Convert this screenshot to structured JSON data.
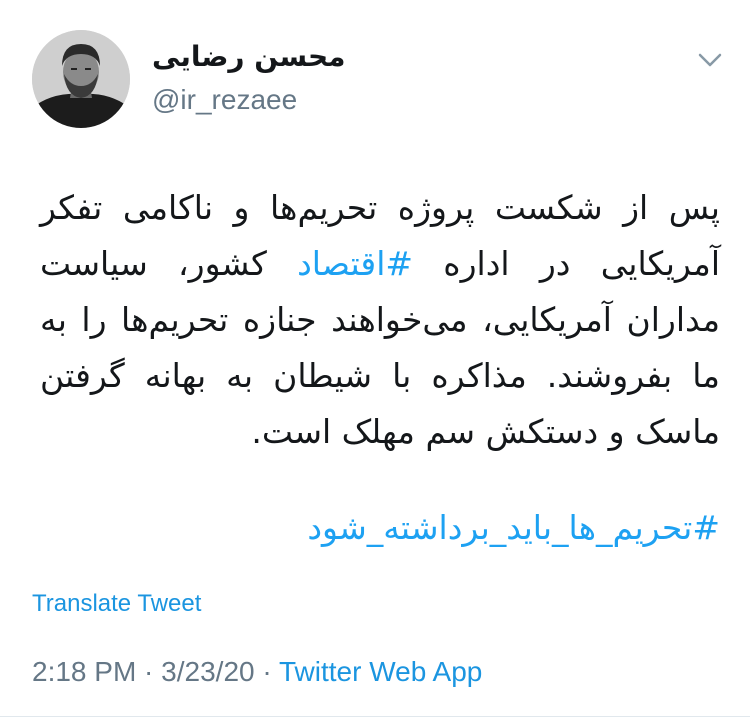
{
  "author": {
    "display_name": "محسن رضایی",
    "handle": "@ir_rezaee"
  },
  "tweet": {
    "text_before_hashtag": "پس از شکست پروژه تحریم‌ها و ناکامی تفکر آمریکایی در اداره ",
    "inline_hashtag": "#اقتصاد",
    "text_after_hashtag": " کشور، سیاست مداران آمریکایی، می‌خواهند جنازه تحریم‌ها را به ما بفروشند. مذاکره با شیطان به بهانه گرفتن ماسک و دستکش سم مهلک است.",
    "closing_hashtag": "#تحریم_ها_باید_برداشته_شود"
  },
  "translate_label": "Translate Tweet",
  "meta": {
    "time": "2:18 PM",
    "separator": " · ",
    "date": "3/23/20",
    "app": "Twitter Web App"
  },
  "icons": {
    "caret": "chevron-down-icon"
  },
  "colors": {
    "link": "#1da1f2",
    "secondary_text": "#657786",
    "primary_text": "#14171a"
  }
}
